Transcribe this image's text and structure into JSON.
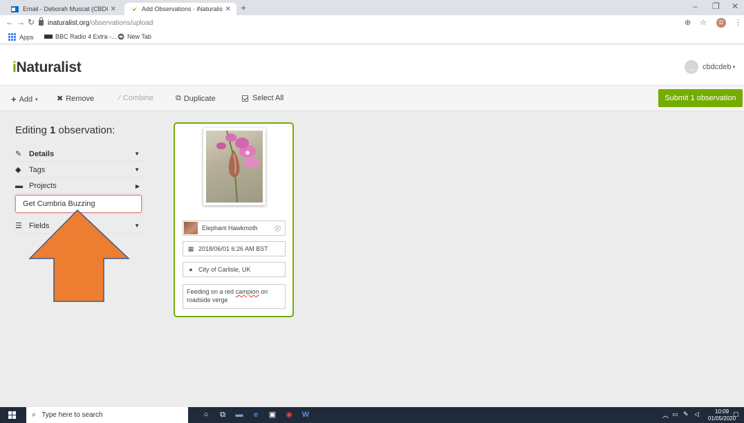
{
  "browser": {
    "tabs": [
      {
        "title": "Email - Deborah Muscat (CBDC)",
        "active": false
      },
      {
        "title": "Add Observations · iNaturalist",
        "active": true
      }
    ],
    "url_host": "inaturalist.org",
    "url_path": "/observations/upload",
    "profile_initial": "D",
    "bookmarks": [
      "Apps",
      "BBC Radio 4 Extra -...",
      "New Tab"
    ]
  },
  "site": {
    "logo_i": "i",
    "logo_rest": "Naturalist",
    "username": "cbdcdeb"
  },
  "actions": {
    "add": "Add",
    "remove": "Remove",
    "combine": "Combine",
    "duplicate": "Duplicate",
    "select_all": "Select All",
    "submit": "Submit 1 observation"
  },
  "editor": {
    "editing_prefix": "Editing ",
    "editing_count": "1",
    "editing_suffix": " observation:",
    "sections": {
      "details": "Details",
      "tags": "Tags",
      "projects": "Projects",
      "fields": "Fields"
    },
    "project_value": "Get Cumbria Buzzing"
  },
  "observation": {
    "taxon": "Elephant Hawkmoth",
    "datetime": "2018/06/01 6:26 AM BST",
    "location": "City of Carlisle, UK",
    "notes_before": "Feeding on a red ",
    "notes_misspelled": "campion",
    "notes_after": " on roadside verge"
  },
  "taskbar": {
    "search_placeholder": "Type here to search",
    "time": "10:09",
    "date": "01/05/2020"
  },
  "colors": {
    "accent_green": "#74ac00",
    "annotation_arrow": "#ed7d31",
    "project_border": "#e07b7b"
  }
}
